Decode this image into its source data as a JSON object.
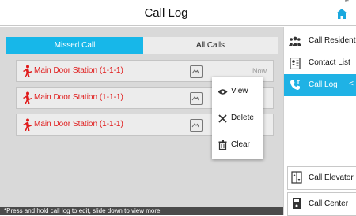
{
  "header": {
    "title": "Call Log",
    "corner_glyph": "e"
  },
  "tabs": [
    {
      "label": "Missed Call",
      "active": true
    },
    {
      "label": "All Calls",
      "active": false
    }
  ],
  "log": [
    {
      "name": "Main Door Station (1-1-1)",
      "time": "Now",
      "icon": "person-icon"
    },
    {
      "name": "Main Door Station (1-1-1)",
      "time": "",
      "icon": "person-icon"
    },
    {
      "name": "Main Door Station (1-1-1)",
      "time": "",
      "icon": "person-icon"
    }
  ],
  "context_menu": [
    {
      "label": "View",
      "icon": "eye-icon"
    },
    {
      "label": "Delete",
      "icon": "close-icon"
    },
    {
      "label": "Clear",
      "icon": "trash-icon"
    }
  ],
  "hint": "*Press and hold call log to edit, slide down to view more.",
  "sidebar": {
    "items": [
      {
        "label": "Call Resident",
        "icon": "residents-icon"
      },
      {
        "label": "Contact List",
        "icon": "contacts-icon"
      },
      {
        "label": "Call Log",
        "icon": "phone-icon",
        "active": true
      }
    ],
    "bottom": [
      {
        "label": "Call Elevator",
        "icon": "elevator-icon"
      },
      {
        "label": "Call Center",
        "icon": "intercom-icon"
      }
    ]
  },
  "colors": {
    "accent": "#17b7e9",
    "missed": "#e01b1b",
    "panel": "#d9d9d9"
  }
}
